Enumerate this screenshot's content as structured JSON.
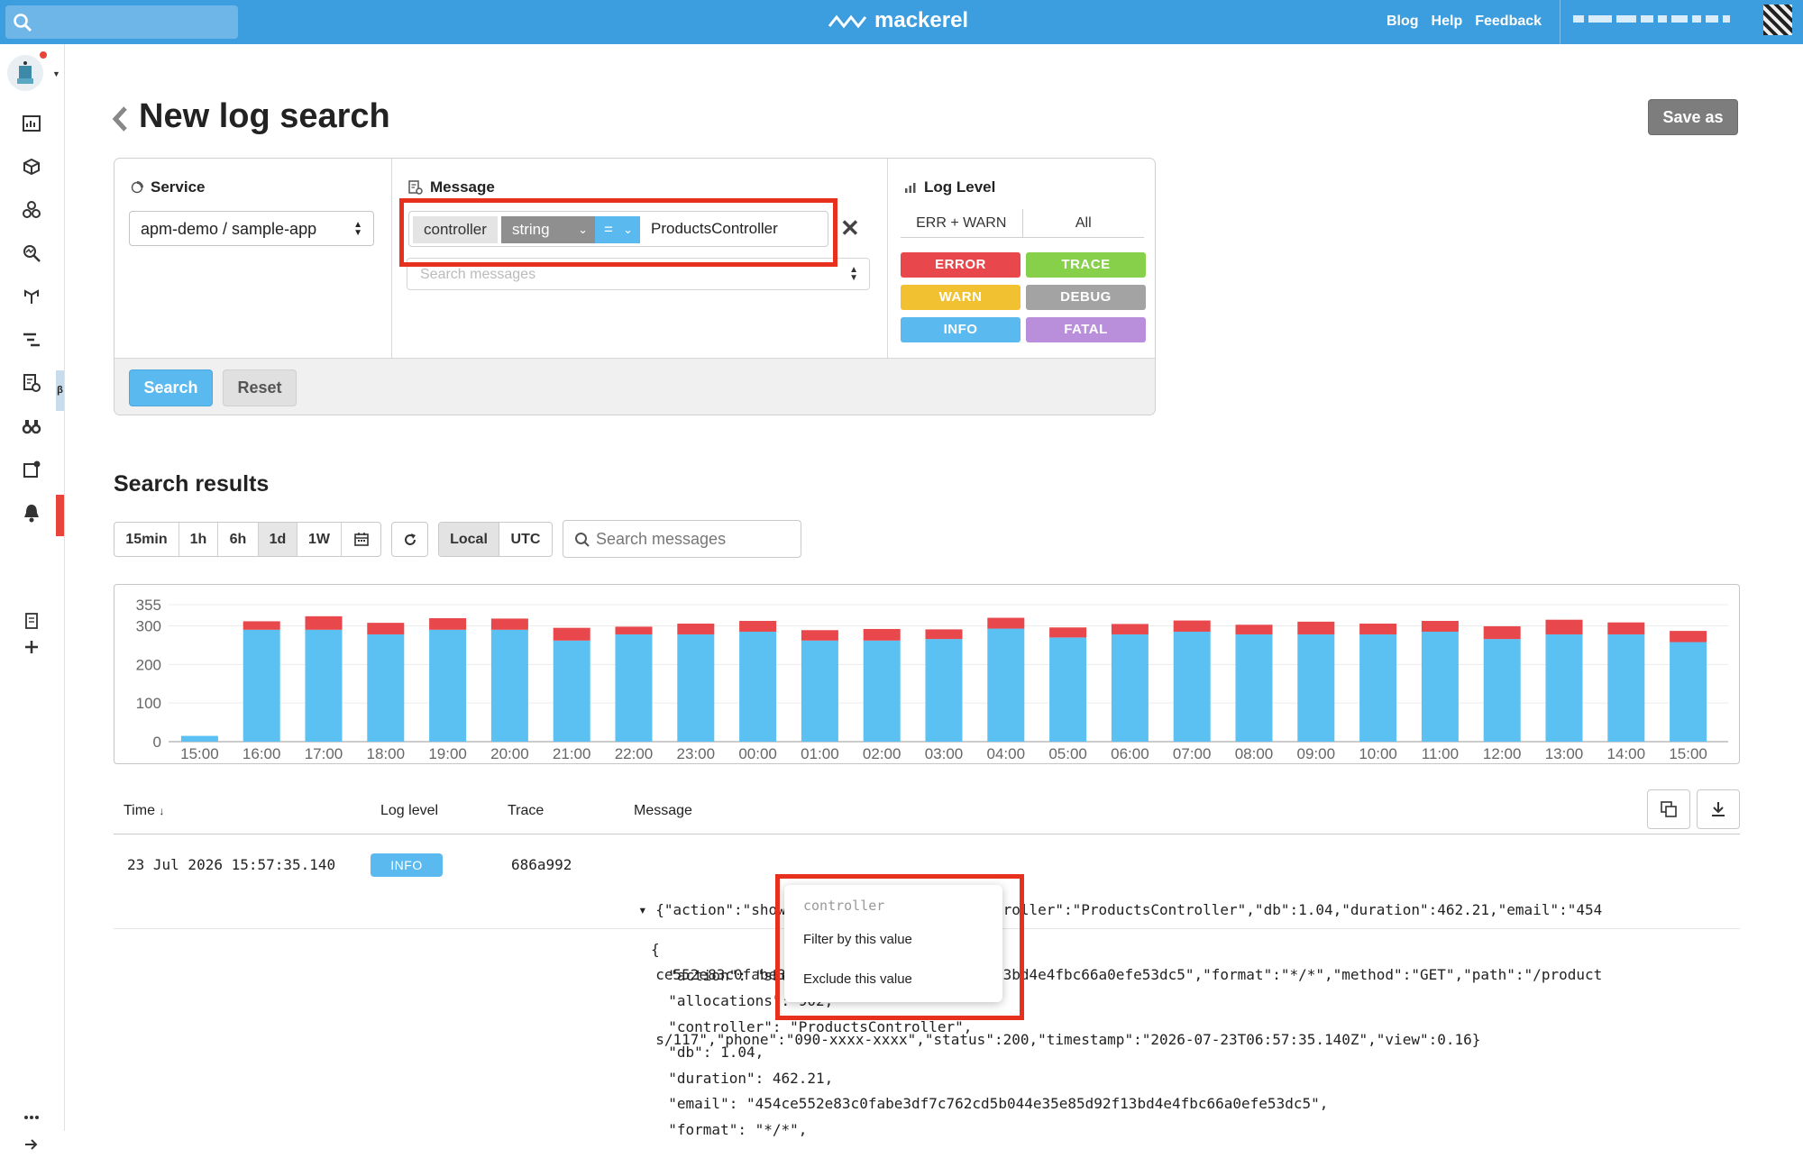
{
  "topbar": {
    "brand": "mackerel",
    "links": [
      "Blog",
      "Help",
      "Feedback"
    ],
    "colors": {
      "bar": "#3c9edf"
    }
  },
  "sidebar": {
    "beta_label": "β",
    "icons": [
      "dashboard-icon",
      "hosts-icon",
      "services-icon",
      "search-icon",
      "apm-icon",
      "trace-icon",
      "logs-icon",
      "monitors-icon",
      "notifications-icon",
      "alerts-icon",
      "docs-icon",
      "add-icon",
      "more-icon",
      "expand-icon"
    ]
  },
  "page": {
    "title": "New log search",
    "save_as": "Save as"
  },
  "filter": {
    "service_label": "Service",
    "service_value": "apm-demo / sample-app",
    "message_label": "Message",
    "key": "controller",
    "type": "string",
    "operator": "=",
    "value": "ProductsController",
    "message_placeholder": "Search messages",
    "level_label": "Log Level",
    "level_presets": [
      "ERR + WARN",
      "All"
    ],
    "levels": [
      {
        "label": "ERROR",
        "color": "#e8474b"
      },
      {
        "label": "TRACE",
        "color": "#86d04a"
      },
      {
        "label": "WARN",
        "color": "#f1c132"
      },
      {
        "label": "DEBUG",
        "color": "#a3a3a3"
      },
      {
        "label": "INFO",
        "color": "#5ab9ee"
      },
      {
        "label": "FATAL",
        "color": "#b98fdb"
      }
    ],
    "search_button": "Search",
    "reset_button": "Reset"
  },
  "results": {
    "title": "Search results",
    "ranges": [
      "15min",
      "1h",
      "6h",
      "1d",
      "1W"
    ],
    "active_range": "1d",
    "timezones": [
      "Local",
      "UTC"
    ],
    "active_timezone": "Local",
    "search_placeholder": "Search messages"
  },
  "chart_data": {
    "type": "bar",
    "stacked": true,
    "ylim": [
      0,
      355
    ],
    "yticks": [
      0,
      100,
      200,
      300,
      355
    ],
    "categories": [
      "15:00",
      "16:00",
      "17:00",
      "18:00",
      "19:00",
      "20:00",
      "21:00",
      "22:00",
      "23:00",
      "00:00",
      "01:00",
      "02:00",
      "03:00",
      "04:00",
      "05:00",
      "06:00",
      "07:00",
      "08:00",
      "09:00",
      "10:00",
      "11:00",
      "12:00",
      "13:00",
      "14:00",
      "15:00"
    ],
    "series": [
      {
        "color": "#5bc1f2",
        "values": [
          15,
          290,
          290,
          278,
          290,
          290,
          262,
          278,
          278,
          285,
          262,
          262,
          266,
          293,
          270,
          278,
          285,
          278,
          278,
          278,
          285,
          266,
          278,
          278,
          258
        ]
      },
      {
        "color": "#e8474b",
        "values": [
          0,
          22,
          35,
          30,
          30,
          29,
          33,
          20,
          28,
          28,
          27,
          30,
          25,
          28,
          26,
          27,
          29,
          25,
          33,
          28,
          28,
          33,
          38,
          31,
          29
        ]
      }
    ]
  },
  "table": {
    "headers": [
      "Time",
      "Log level",
      "Trace",
      "Message"
    ],
    "sort_indicator": "↓",
    "row": {
      "time": "23 Jul 2026 15:57:35.140",
      "level": "INFO",
      "trace": "686a992",
      "message_lines": [
        "▾ {\"action\":\"show\",\"allocations\":902,\"controller\":\"ProductsController\",\"db\":1.04,\"duration\":462.21,\"email\":\"454",
        "  ce552e83c0fabe3df7c762cd5b044e35e85d92f13bd4e4fbc66a0efe53dc5\",\"format\":\"*/*\",\"method\":\"GET\",\"path\":\"/product",
        "  s/117\",\"phone\":\"090-xxxx-xxxx\",\"status\":200,\"timestamp\":\"2026-07-23T06:57:35.140Z\",\"view\":0.16}"
      ]
    },
    "json_lines": [
      "{",
      "  \"action\": \"show\",",
      "  \"allocations\": 902,",
      "  \"controller\": \"ProductsController\",",
      "  \"db\": 1.04,",
      "  \"duration\": 462.21,",
      "  \"email\": \"454ce552e83c0fabe3df7c762cd5b044e35e85d92f13bd4e4fbc66a0efe53dc5\",",
      "  \"format\": \"*/*\","
    ]
  },
  "popup": {
    "header": "controller",
    "items": [
      "Filter by this value",
      "Exclude this value"
    ]
  }
}
